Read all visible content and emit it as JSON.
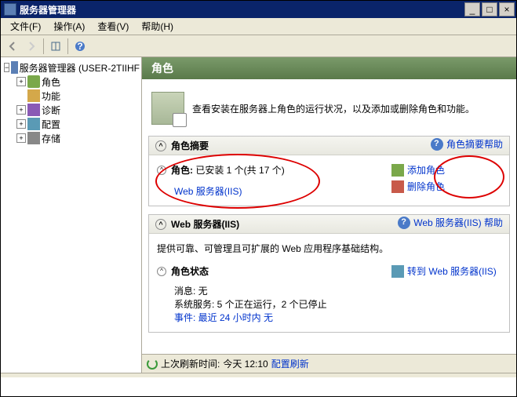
{
  "window": {
    "title": "服务器管理器"
  },
  "menu": {
    "file": "文件(F)",
    "action": "操作(A)",
    "view": "查看(V)",
    "help": "帮助(H)"
  },
  "tree": {
    "root": "服务器管理器 (USER-2TIIHF",
    "items": [
      {
        "label": "角色"
      },
      {
        "label": "功能"
      },
      {
        "label": "诊断"
      },
      {
        "label": "配置"
      },
      {
        "label": "存储"
      }
    ]
  },
  "content": {
    "header": "角色",
    "intro": "查看安装在服务器上角色的运行状况，以及添加或删除角色和功能。",
    "summary": {
      "title": "角色摘要",
      "help": "角色摘要帮助",
      "roles_label": "角色:",
      "roles_count": "已安装 1 个(共 17 个)",
      "iis": "Web 服务器(IIS)",
      "add": "添加角色",
      "remove": "删除角色"
    },
    "webserver": {
      "title": "Web 服务器(IIS)",
      "help": "Web 服务器(IIS) 帮助",
      "desc": "提供可靠、可管理且可扩展的 Web 应用程序基础结构。",
      "status_title": "角色状态",
      "goto": "转到 Web 服务器(IIS)",
      "msg": "消息: 无",
      "svc": "系统服务: 5 个正在运行，2 个已停止",
      "evt": "事件: 最近 24 小时内 无"
    }
  },
  "status": {
    "refresh_label": "上次刷新时间:",
    "refresh_time": "今天 12:10",
    "config": "配置刷新"
  }
}
